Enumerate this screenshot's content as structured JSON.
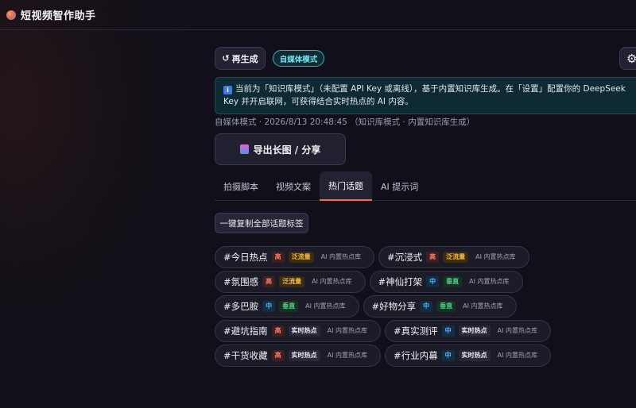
{
  "app": {
    "title": "短视频智作助手",
    "logo_icon": "app-logo-icon"
  },
  "toolbar": {
    "regenerate_icon": "↺",
    "regenerate_label": "再生成",
    "mode_badge": "自媒体模式",
    "settings_icon": "⚙"
  },
  "notice": {
    "icon": "i",
    "text": "当前为「知识库模式」（未配置 API Key 或离线），基于内置知识库生成。在「设置」配置你的 DeepSeek Key 并开启联网，可获得结合实时热点的 AI 内容。"
  },
  "meta": {
    "text": "自媒体模式 · 2026/8/13 20:48:45 （知识库模式 · 内置知识库生成）"
  },
  "export": {
    "label": "导出长图 / 分享"
  },
  "tabs": [
    {
      "label": "拍摄脚本",
      "active": false
    },
    {
      "label": "视频文案",
      "active": false
    },
    {
      "label": "热门话题",
      "active": true
    },
    {
      "label": "AI 提示词",
      "active": false
    }
  ],
  "copy_all": {
    "label": "一键复制全部话题标签"
  },
  "topics": [
    {
      "tag": "#今日热点",
      "level": "高",
      "type": "泛流量",
      "source": "AI 内置热点库"
    },
    {
      "tag": "#沉浸式",
      "level": "高",
      "type": "泛流量",
      "source": "AI 内置热点库"
    },
    {
      "tag": "#氛围感",
      "level": "高",
      "type": "泛流量",
      "source": "AI 内置热点库"
    },
    {
      "tag": "#神仙打架",
      "level": "中",
      "type": "垂直",
      "source": "AI 内置热点库"
    },
    {
      "tag": "#多巴胺",
      "level": "中",
      "type": "垂直",
      "source": "AI 内置热点库"
    },
    {
      "tag": "#好物分享",
      "level": "中",
      "type": "垂直",
      "source": "AI 内置热点库"
    },
    {
      "tag": "#避坑指南",
      "level": "高",
      "type": "实时热点",
      "source": "AI 内置热点库"
    },
    {
      "tag": "#真实测评",
      "level": "中",
      "type": "实时热点",
      "source": "AI 内置热点库"
    },
    {
      "tag": "#干货收藏",
      "level": "高",
      "type": "实时热点",
      "source": "AI 内置热点库"
    },
    {
      "tag": "#行业内幕",
      "level": "中",
      "type": "实时热点",
      "source": "AI 内置热点库"
    }
  ],
  "colors": {
    "accent_tab": "#f06a4a",
    "mode_badge": "#1fb6c9"
  }
}
